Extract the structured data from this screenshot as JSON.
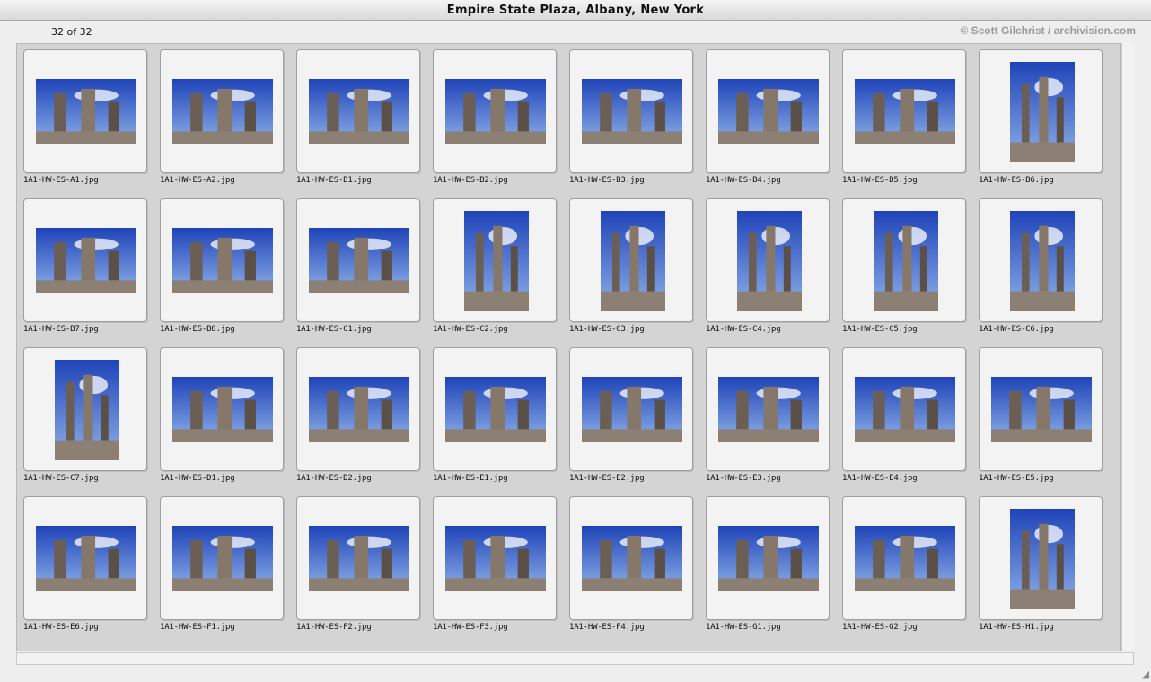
{
  "window": {
    "title": "Empire State Plaza, Albany, New York"
  },
  "gallery": {
    "counter": "32 of 32",
    "credit": "© Scott Gilchrist / archivision.com",
    "items": [
      {
        "name": "1A1-HW-ES-A1.jpg",
        "orientation": "landscape"
      },
      {
        "name": "1A1-HW-ES-A2.jpg",
        "orientation": "landscape"
      },
      {
        "name": "1A1-HW-ES-B1.jpg",
        "orientation": "landscape"
      },
      {
        "name": "1A1-HW-ES-B2.jpg",
        "orientation": "landscape"
      },
      {
        "name": "1A1-HW-ES-B3.jpg",
        "orientation": "landscape"
      },
      {
        "name": "1A1-HW-ES-B4.jpg",
        "orientation": "landscape"
      },
      {
        "name": "1A1-HW-ES-B5.jpg",
        "orientation": "landscape"
      },
      {
        "name": "1A1-HW-ES-B6.jpg",
        "orientation": "portrait"
      },
      {
        "name": "1A1-HW-ES-B7.jpg",
        "orientation": "landscape"
      },
      {
        "name": "1A1-HW-ES-B8.jpg",
        "orientation": "landscape"
      },
      {
        "name": "1A1-HW-ES-C1.jpg",
        "orientation": "landscape"
      },
      {
        "name": "1A1-HW-ES-C2.jpg",
        "orientation": "portrait"
      },
      {
        "name": "1A1-HW-ES-C3.jpg",
        "orientation": "portrait"
      },
      {
        "name": "1A1-HW-ES-C4.jpg",
        "orientation": "portrait"
      },
      {
        "name": "1A1-HW-ES-C5.jpg",
        "orientation": "portrait"
      },
      {
        "name": "1A1-HW-ES-C6.jpg",
        "orientation": "portrait"
      },
      {
        "name": "1A1-HW-ES-C7.jpg",
        "orientation": "portrait"
      },
      {
        "name": "1A1-HW-ES-D1.jpg",
        "orientation": "landscape"
      },
      {
        "name": "1A1-HW-ES-D2.jpg",
        "orientation": "landscape"
      },
      {
        "name": "1A1-HW-ES-E1.jpg",
        "orientation": "landscape"
      },
      {
        "name": "1A1-HW-ES-E2.jpg",
        "orientation": "landscape"
      },
      {
        "name": "1A1-HW-ES-E3.jpg",
        "orientation": "landscape"
      },
      {
        "name": "1A1-HW-ES-E4.jpg",
        "orientation": "landscape"
      },
      {
        "name": "1A1-HW-ES-E5.jpg",
        "orientation": "landscape"
      },
      {
        "name": "1A1-HW-ES-E6.jpg",
        "orientation": "landscape"
      },
      {
        "name": "1A1-HW-ES-F1.jpg",
        "orientation": "landscape"
      },
      {
        "name": "1A1-HW-ES-F2.jpg",
        "orientation": "landscape"
      },
      {
        "name": "1A1-HW-ES-F3.jpg",
        "orientation": "landscape"
      },
      {
        "name": "1A1-HW-ES-F4.jpg",
        "orientation": "landscape"
      },
      {
        "name": "1A1-HW-ES-G1.jpg",
        "orientation": "landscape"
      },
      {
        "name": "1A1-HW-ES-G2.jpg",
        "orientation": "landscape"
      },
      {
        "name": "1A1-HW-ES-H1.jpg",
        "orientation": "portrait"
      }
    ]
  },
  "icons": {
    "resize": "resize-grip-icon"
  },
  "colors": {
    "sky": "#2b55c8",
    "ground": "#8c7f73",
    "panel": "#d4d4d4"
  }
}
